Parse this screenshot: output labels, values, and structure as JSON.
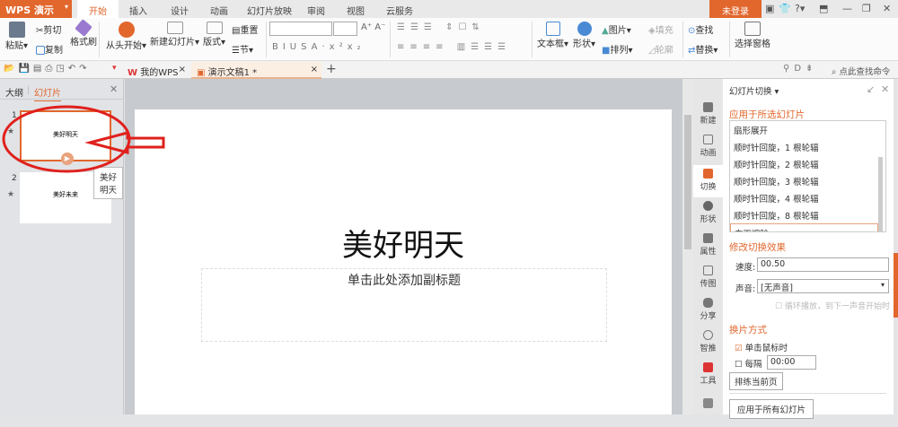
{
  "app": {
    "logo": "WPS 演示",
    "login": "未登录"
  },
  "menu_tabs": [
    "开始",
    "插入",
    "设计",
    "动画",
    "幻灯片放映",
    "审阅",
    "视图",
    "云服务"
  ],
  "ribbon": {
    "paste": "粘贴",
    "cut": "剪切",
    "copy": "复制",
    "format_painter": "格式刷",
    "play_from_start": "从头开始",
    "new_slide": "新建幻灯片",
    "layout": "版式",
    "reset": "重置",
    "section": "节",
    "textbox": "文本框",
    "shape": "形状",
    "picture": "图片",
    "fill": "填充",
    "arrange": "排列",
    "outline": "轮廓",
    "find": "查找",
    "replace": "替换",
    "selection_pane": "选择窗格"
  },
  "doc_tabs": {
    "my_wps": "我的WPS",
    "doc": "演示文稿1 *"
  },
  "search_cmd": "点此查找命令",
  "left_panel": {
    "outline_tab": "大纲",
    "slides_tab": "幻灯片",
    "slides": [
      {
        "num": "1",
        "title": "美好明天"
      },
      {
        "num": "2",
        "title": "美好未来"
      }
    ],
    "tooltip": "美好明天"
  },
  "slide": {
    "title": "美好明天",
    "subtitle": "单击此处添加副标题"
  },
  "sidebar": [
    "新建",
    "动画",
    "切换",
    "形状",
    "属性",
    "传图",
    "分享",
    "智推",
    "工具"
  ],
  "pane": {
    "title": "幻灯片切换",
    "apply_selected": "应用于所选幻灯片",
    "transitions": [
      "扇形展开",
      "顺时针回旋，1 根轮辐",
      "顺时针回旋，2 根轮辐",
      "顺时针回旋，3 根轮辐",
      "顺时针回旋，4 根轮辐",
      "顺时针回旋，8 根轮辐",
      "向下擦除"
    ],
    "modify": "修改切换效果",
    "speed_label": "速度:",
    "speed": "00.50",
    "sound_label": "声音:",
    "sound": "[无声音]",
    "loop": "循环播放，到下一声音开始时",
    "advance": "换片方式",
    "on_click": "单击鼠标时",
    "every": "每隔",
    "every_value": "00:00",
    "rehearse": "排练当前页",
    "apply_all": "应用于所有幻灯片"
  },
  "colors": {
    "accent": "#e2672d",
    "annotation": "#e0201c"
  }
}
